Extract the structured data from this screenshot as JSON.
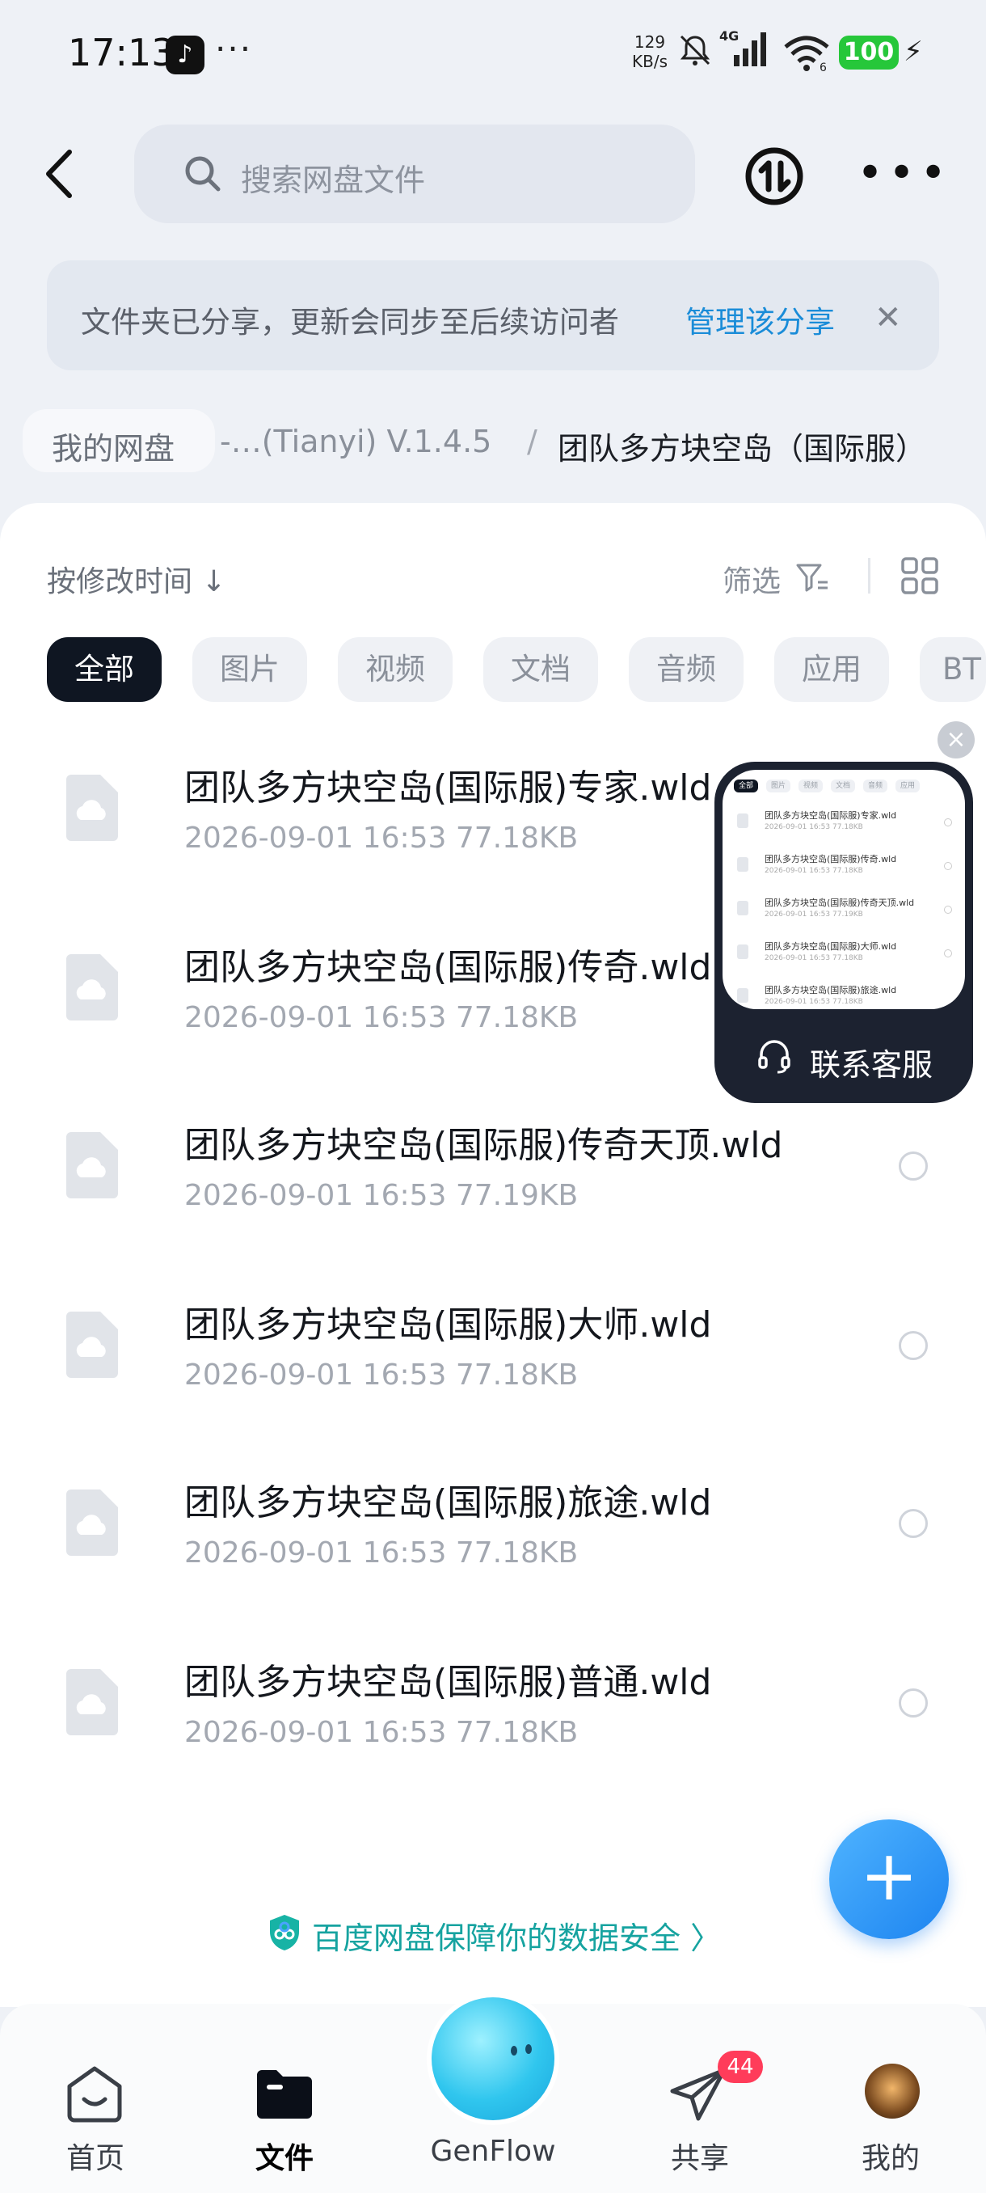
{
  "status_bar": {
    "time": "17:13",
    "more": "···",
    "net_speed_value": "129",
    "net_speed_unit": "KB/s",
    "network": "4G",
    "wifi_sub": "6",
    "battery": "100"
  },
  "header": {
    "search_placeholder": "搜索网盘文件"
  },
  "notice": {
    "text": "文件夹已分享，更新会同步至后续访问者",
    "manage_label": "管理该分享",
    "close": "✕"
  },
  "breadcrumb": {
    "home": "我的网盘",
    "middle": "-…(Tianyi) V.1.4.5",
    "separator": "/",
    "current": "团队多方块空岛（国际服）"
  },
  "toolbar": {
    "sort_label": "按修改时间 ↓",
    "filter_label": "筛选"
  },
  "chips": [
    "全部",
    "图片",
    "视频",
    "文档",
    "音频",
    "应用",
    "BT"
  ],
  "files": [
    {
      "name": "团队多方块空岛(国际服)专家.wld",
      "date": "2026-09-01",
      "time": "16:53",
      "size": "77.18KB"
    },
    {
      "name": "团队多方块空岛(国际服)传奇.wld",
      "date": "2026-09-01",
      "time": "16:53",
      "size": "77.18KB"
    },
    {
      "name": "团队多方块空岛(国际服)传奇天顶.wld",
      "date": "2026-09-01",
      "time": "16:53",
      "size": "77.19KB"
    },
    {
      "name": "团队多方块空岛(国际服)大师.wld",
      "date": "2026-09-01",
      "time": "16:53",
      "size": "77.18KB"
    },
    {
      "name": "团队多方块空岛(国际服)旅途.wld",
      "date": "2026-09-01",
      "time": "16:53",
      "size": "77.18KB"
    },
    {
      "name": "团队多方块空岛(国际服)普通.wld",
      "date": "2026-09-01",
      "time": "16:53",
      "size": "77.18KB"
    }
  ],
  "service_window": {
    "label": "联系客服",
    "close": "×"
  },
  "fab": "+",
  "security_text": "百度网盘保障你的数据安全 〉",
  "bottom_nav": {
    "home": "首页",
    "files": "文件",
    "genflow": "GenFlow",
    "share": "共享",
    "share_badge": "44",
    "me": "我的"
  }
}
